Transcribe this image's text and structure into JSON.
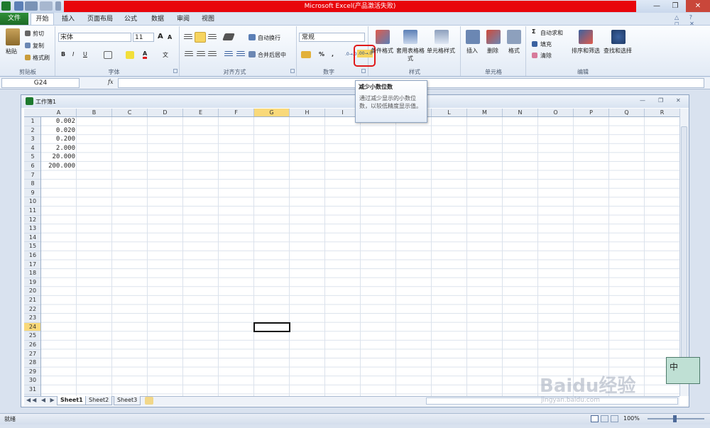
{
  "window": {
    "title": "Microsoft Excel(产品激活失败)",
    "minimize": "—",
    "restore": "❐",
    "close": "✕"
  },
  "tabs": {
    "file": "文件",
    "items": [
      "开始",
      "插入",
      "页面布局",
      "公式",
      "数据",
      "审阅",
      "视图"
    ]
  },
  "ribbon": {
    "clipboard": {
      "paste": "粘贴",
      "cut": "剪切",
      "copy": "复制",
      "format_painter": "格式刷",
      "group": "剪贴板"
    },
    "font": {
      "name": "宋体",
      "size": "11",
      "group": "字体",
      "bold": "B",
      "italic": "I",
      "underline": "U",
      "grow": "A",
      "shrink": "A",
      "color_a": "A",
      "phonetic": "文"
    },
    "align": {
      "wrap": "自动换行",
      "merge": "合并后居中",
      "group": "对齐方式"
    },
    "number": {
      "format": "常规",
      "percent": "%",
      "comma": ",",
      "increase": ".0→.00",
      "decrease": ".00→.0",
      "group": "数字"
    },
    "styles": {
      "cond": "条件格式",
      "table": "套用表格格式",
      "cell": "单元格样式",
      "group": "样式"
    },
    "cells": {
      "insert": "插入",
      "delete": "删除",
      "format": "格式",
      "group": "单元格"
    },
    "editing": {
      "autosum": "自动求和",
      "fill": "填充",
      "clear": "清除",
      "sort": "排序和筛选",
      "find": "查找和选择",
      "group": "编辑"
    }
  },
  "formula": {
    "namebox": "G24",
    "fx": "fx",
    "value": ""
  },
  "tooltip": {
    "title": "减少小数位数",
    "body": "通过减少显示的小数位数，以较低精度显示值。"
  },
  "workbook": {
    "title": "工作簿1"
  },
  "columns": [
    "A",
    "B",
    "C",
    "D",
    "E",
    "F",
    "G",
    "H",
    "I",
    "J",
    "K",
    "L",
    "M",
    "N",
    "O",
    "P",
    "Q",
    "R"
  ],
  "rows": [
    "1",
    "2",
    "3",
    "4",
    "5",
    "6",
    "7",
    "8",
    "9",
    "10",
    "11",
    "12",
    "13",
    "14",
    "15",
    "16",
    "17",
    "18",
    "19",
    "20",
    "21",
    "22",
    "23",
    "24",
    "25",
    "26",
    "27",
    "28",
    "29",
    "30",
    "31"
  ],
  "cells_A": [
    "0.002",
    "0.020",
    "0.200",
    "2.000",
    "20.000",
    "200.000"
  ],
  "sheets": [
    "Sheet1",
    "Sheet2",
    "Sheet3"
  ],
  "status": {
    "ready": "就绪",
    "zoom": "100%"
  },
  "watermark": {
    "logo": "Baidu经验",
    "url": "jingyan.baidu.com",
    "badge": "中"
  },
  "colors": {
    "accent_red": "#e8050b",
    "file_green": "#1d6b26",
    "selected_col": "#f9d97a"
  }
}
